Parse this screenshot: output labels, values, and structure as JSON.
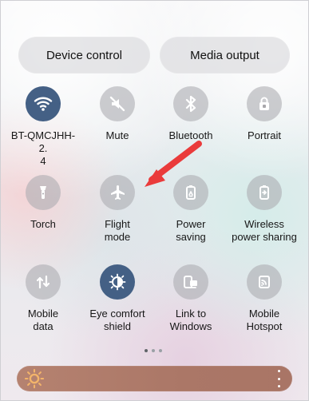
{
  "header": {
    "device_control": "Device control",
    "media_output": "Media output"
  },
  "tiles": [
    {
      "label": "BT-QMCJHH-2.\n4",
      "icon": "wifi-icon",
      "active": true
    },
    {
      "label": "Mute",
      "icon": "mute-icon",
      "active": false
    },
    {
      "label": "Bluetooth",
      "icon": "bluetooth-icon",
      "active": false
    },
    {
      "label": "Portrait",
      "icon": "portrait-icon",
      "active": false
    },
    {
      "label": "Torch",
      "icon": "torch-icon",
      "active": false
    },
    {
      "label": "Flight\nmode",
      "icon": "airplane-icon",
      "active": false
    },
    {
      "label": "Power\nsaving",
      "icon": "power-saving-icon",
      "active": false
    },
    {
      "label": "Wireless\npower sharing",
      "icon": "wireless-power-sharing-icon",
      "active": false
    },
    {
      "label": "Mobile\ndata",
      "icon": "mobile-data-icon",
      "active": false
    },
    {
      "label": "Eye comfort\nshield",
      "icon": "eye-comfort-icon",
      "active": true
    },
    {
      "label": "Link to\nWindows",
      "icon": "link-windows-icon",
      "active": false
    },
    {
      "label": "Mobile\nHotspot",
      "icon": "hotspot-icon",
      "active": false
    }
  ],
  "page_indicator": {
    "current": 1,
    "total": 3
  },
  "brightness": {
    "icon": "sun-icon",
    "more_icon": "more-vertical-icon",
    "level": 1
  },
  "annotation": {
    "color": "#ea3b3b",
    "target": "Flight mode"
  },
  "colors": {
    "active_tile": "#446085",
    "brightness_bar": "#ad7868",
    "annotation_arrow": "#ea3b3b"
  }
}
